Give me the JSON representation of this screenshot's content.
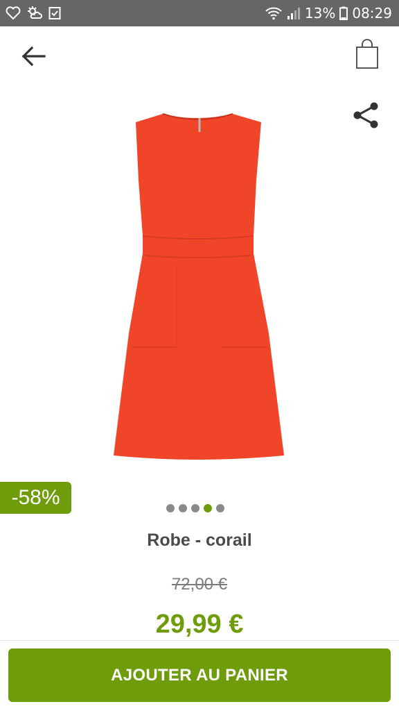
{
  "status_bar": {
    "left_icons": [
      "heart-icon",
      "weather-icon",
      "checkbox-icon"
    ],
    "battery_percent": "13%",
    "time": "08:29"
  },
  "app_bar": {
    "back_icon": "arrow-left-icon",
    "bag_icon": "shopping-bag-icon"
  },
  "product": {
    "share_icon": "share-icon",
    "image_description_color": "#f1452a",
    "discount": "-58%",
    "carousel": {
      "count": 5,
      "active_index": 3
    },
    "title": "Robe - corail",
    "old_price": "72,00 €",
    "new_price": "29,99 €"
  },
  "cta": {
    "add_to_cart": "AJOUTER AU PANIER"
  },
  "colors": {
    "accent": "#6e9c0b",
    "status_bar": "#666666",
    "text": "#4a4a4a"
  }
}
